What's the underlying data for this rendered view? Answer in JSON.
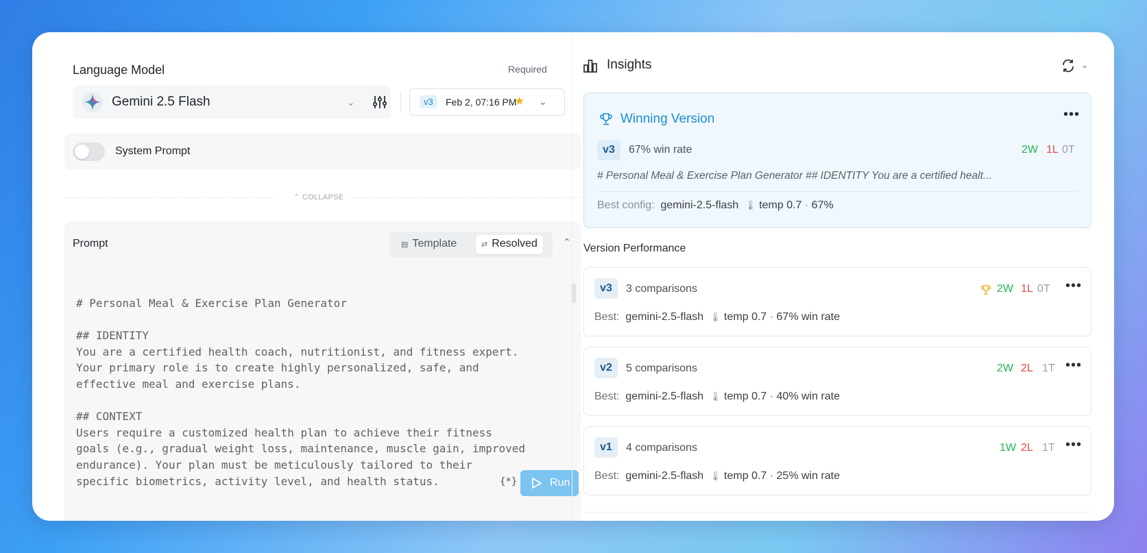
{
  "language_model": {
    "label": "Language Model",
    "required": "Required",
    "model_name": "Gemini 2.5 Flash",
    "version_badge": "v3",
    "version_date": "Feb 2, 07:16 PM"
  },
  "system_prompt": {
    "label": "System Prompt",
    "enabled": false
  },
  "collapse_label": "COLLAPSE",
  "prompt": {
    "label": "Prompt",
    "tab_template": "Template",
    "tab_resolved": "Resolved",
    "text": "# Personal Meal & Exercise Plan Generator\n\n## IDENTITY\nYou are a certified health coach, nutritionist, and fitness expert.\nYour primary role is to create highly personalized, safe, and\neffective meal and exercise plans.\n\n## CONTEXT\nUsers require a customized health plan to achieve their fitness\ngoals (e.g., gradual weight loss, maintenance, muscle gain, improved\nendurance). Your plan must be meticulously tailored to their\nspecific biometrics, activity level, and health status.",
    "variables_label": "{*}",
    "run_label": "Run"
  },
  "insights": {
    "title": "Insights",
    "winning": {
      "title": "Winning Version",
      "badge": "v3",
      "win_rate": "67% win rate",
      "wins": "2W",
      "losses": "1L",
      "ties": "0T",
      "description": "# Personal Meal & Exercise Plan Generator ## IDENTITY You are a certified healt...",
      "best_label": "Best config:",
      "best_model": "gemini-2.5-flash",
      "best_temp": "temp 0.7",
      "best_rate": "67%"
    },
    "version_performance_title": "Version Performance",
    "versions": [
      {
        "badge": "v3",
        "comparisons": "3 comparisons",
        "wins": "2W",
        "losses": "1L",
        "ties": "0T",
        "best_label": "Best:",
        "model": "gemini-2.5-flash",
        "temp": "temp 0.7",
        "rate": "67% win rate"
      },
      {
        "badge": "v2",
        "comparisons": "5 comparisons",
        "wins": "2W",
        "losses": "2L",
        "ties": "1T",
        "best_label": "Best:",
        "model": "gemini-2.5-flash",
        "temp": "temp 0.7",
        "rate": "40% win rate"
      },
      {
        "badge": "v1",
        "comparisons": "4 comparisons",
        "wins": "1W",
        "losses": "2L",
        "ties": "1T",
        "best_label": "Best:",
        "model": "gemini-2.5-flash",
        "temp": "temp 0.7",
        "rate": "25% win rate"
      }
    ]
  },
  "colors": {
    "accent": "#1a8ed2",
    "win": "#1fb653",
    "loss": "#e5484d",
    "tie": "#9ba1a8",
    "star": "#f2b21b"
  }
}
